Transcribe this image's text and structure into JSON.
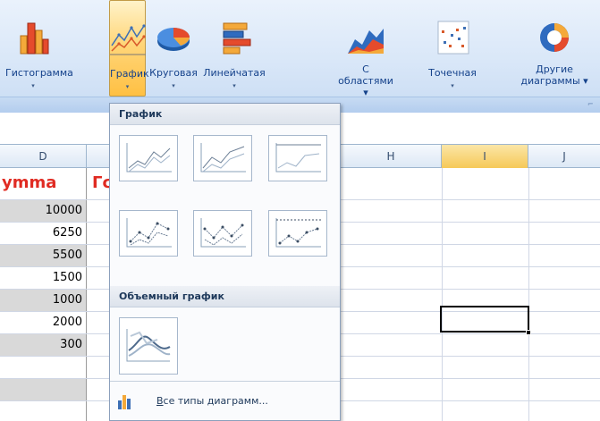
{
  "ribbon": {
    "buttons": [
      {
        "label": "Гистограмма",
        "icon": "column-chart-icon"
      },
      {
        "label": "График",
        "icon": "line-chart-icon"
      },
      {
        "label": "Круговая",
        "icon": "pie-chart-icon"
      },
      {
        "label": "Линейчатая",
        "icon": "bar-chart-icon"
      },
      {
        "label": "С\nобластями ▾",
        "icon": "area-chart-icon"
      },
      {
        "label": "Точечная",
        "icon": "scatter-chart-icon"
      },
      {
        "label": "Другие\nдиаграммы ▾",
        "icon": "other-charts-icon"
      }
    ],
    "arrow": "▾"
  },
  "colors": {
    "header_red": "#e02b22",
    "selection_orange": "#f6c958",
    "ribbon_blue": "#d9e7f8"
  },
  "columns": [
    "D",
    "H",
    "I",
    "J"
  ],
  "sheet": {
    "header_text": "ymma",
    "header_text_e": "Гс",
    "values": [
      "10000",
      "6250",
      "5500",
      "1500",
      "1000",
      "2000",
      "300"
    ]
  },
  "dropdown": {
    "section1": "График",
    "section2": "Объемный график",
    "all_types_prefix": "В",
    "all_types_rest": "се типы диаграмм..."
  }
}
